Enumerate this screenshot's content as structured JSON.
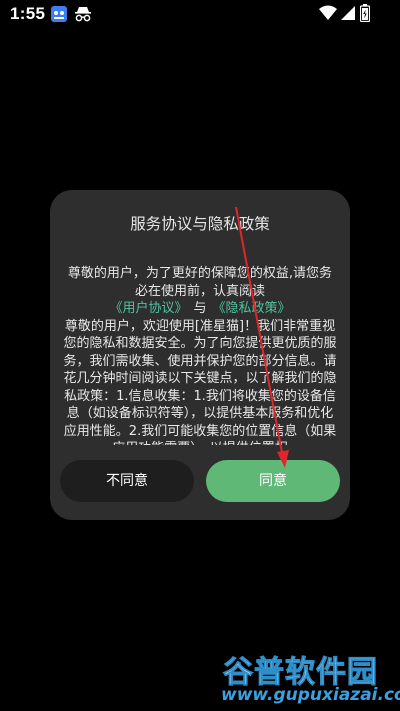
{
  "status_bar": {
    "time": "1:55",
    "icons": [
      "app-notification-icon",
      "incognito-icon",
      "wifi-icon",
      "signal-icon",
      "battery-icon"
    ]
  },
  "dialog": {
    "title": "服务协议与隐私政策",
    "intro": "尊敬的用户，为了更好的保障您的权益,请您务必在使用前，认真阅读",
    "user_agreement_link": "《用户协议》",
    "and_text": "与",
    "privacy_policy_link": "《隐私政策》",
    "body": "尊敬的用户，欢迎使用[准星猫]！我们非常重视您的隐私和数据安全。为了向您提供更优质的服务，我们需收集、使用并保护您的部分信息。请花几分钟时间阅读以下关键点，以了解我们的隐私政策：1.信息收集：1.我们将收集您的设备信息（如设备标识符等），以提供基本服务和优化应用性能。2.我们可能收集您的位置信息（如果应用功能需要），以提供位置相",
    "disagree_label": "不同意",
    "agree_label": "同意"
  },
  "colors": {
    "dialog_bg": "#2e2e2e",
    "link": "#4fc3a1",
    "agree_button": "#5fb876",
    "disagree_button": "#1e1e1e",
    "annotation_arrow": "#e0262c"
  },
  "watermark": {
    "title": "谷普软件园",
    "url": "www.gupuxiazai.com"
  }
}
